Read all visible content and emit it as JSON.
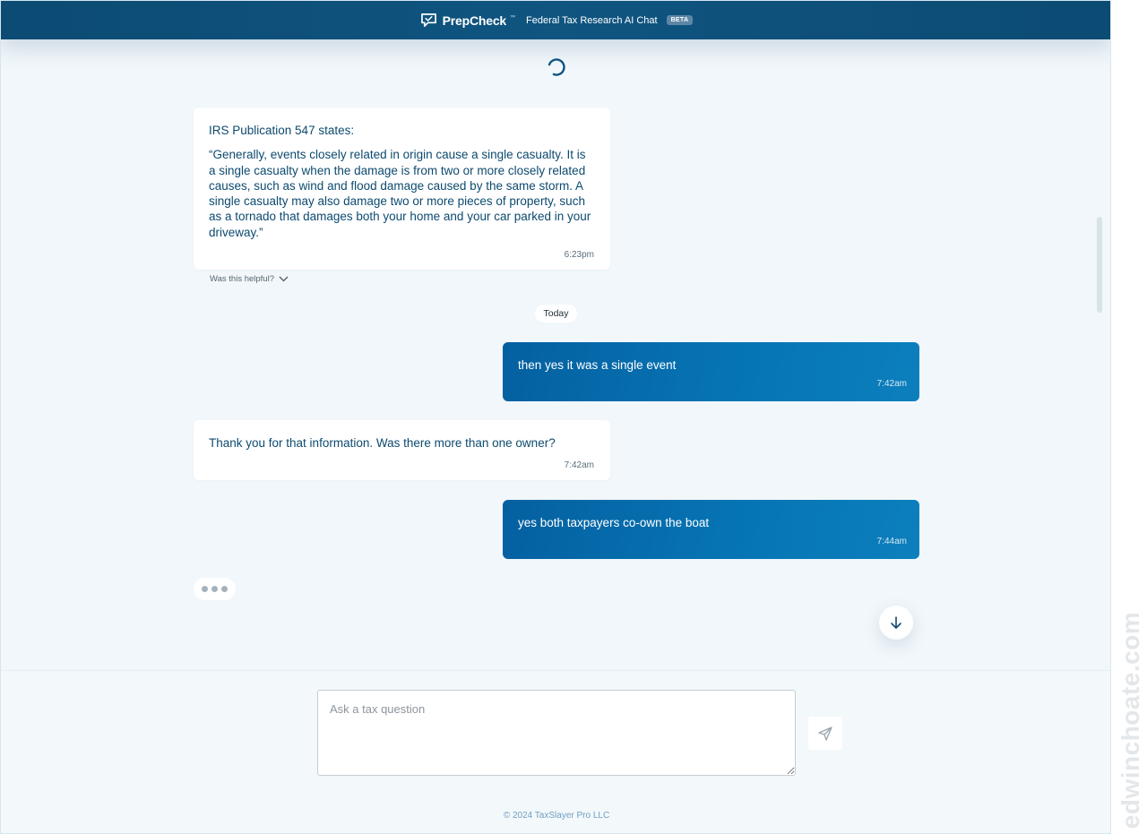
{
  "header": {
    "brand_name": "PrepCheck",
    "brand_tm": "™",
    "subtitle": "Federal Tax Research AI Chat",
    "badge": "BETA"
  },
  "messages": [
    {
      "role": "assistant",
      "paragraphs": [
        "IRS Publication 547 states:",
        "“Generally, events closely related in origin cause a single casualty. It is a single casualty when the damage is from two or more closely related causes, such as wind and flood damage caused by the same storm. A single casualty may also damage two or more pieces of property, such as a tornado that damages both your home and your car parked in your driveway.”"
      ],
      "time": "6:23pm",
      "feedback_label": "Was this helpful?"
    },
    {
      "role": "divider",
      "label": "Today"
    },
    {
      "role": "user",
      "text": "then yes it was a single event",
      "time": "7:42am"
    },
    {
      "role": "assistant",
      "text": "Thank you for that information. Was there more than one owner?",
      "time": "7:42am"
    },
    {
      "role": "user",
      "text": "yes both taxpayers co-own the boat",
      "time": "7:44am"
    }
  ],
  "composer": {
    "placeholder": "Ask a tax question",
    "value": ""
  },
  "footer": "© 2024 TaxSlayer Pro LLC",
  "watermark": "edwinchoate.com",
  "icons": {
    "logo": "chat-bubble-check-icon",
    "loading": "spinner-icon",
    "feedback": "chevron-down-icon",
    "scroll": "arrow-down-icon",
    "send": "paper-plane-icon"
  },
  "colors": {
    "header_bg": "#0f5580",
    "user_bubble": "#0674b4",
    "bot_text": "#0d4a6f",
    "page_bg": "#f1f7fb"
  }
}
